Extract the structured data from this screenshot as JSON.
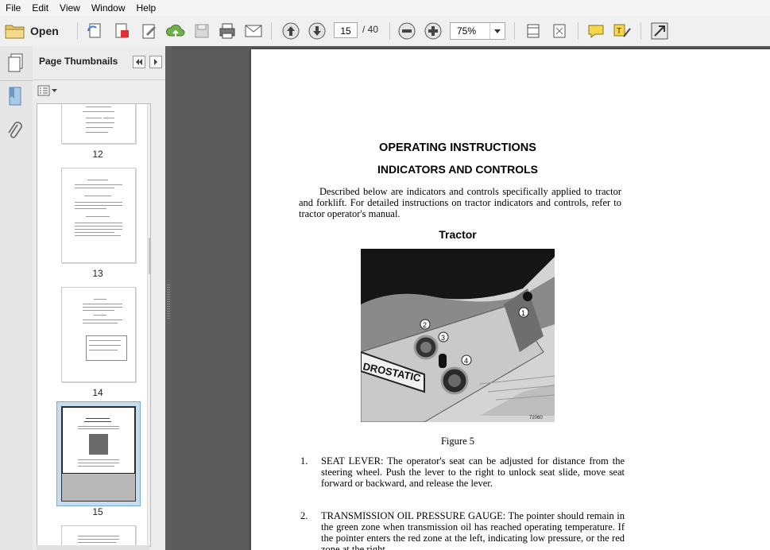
{
  "menu": [
    "File",
    "Edit",
    "View",
    "Window",
    "Help"
  ],
  "toolbar": {
    "open_label": "Open",
    "current_page": "15",
    "page_total": "/ 40",
    "zoom": "75%"
  },
  "nav_panel": {
    "title": "Page Thumbnails",
    "thumbnails": [
      {
        "label": "12"
      },
      {
        "label": "13"
      },
      {
        "label": "14"
      },
      {
        "label": "15",
        "selected": true
      }
    ]
  },
  "document": {
    "heading1": "OPERATING INSTRUCTIONS",
    "heading2": "INDICATORS AND CONTROLS",
    "intro": "Described below are indicators and controls specifically applied to tractor and forklift. For detailed instructions on tractor indicators and controls, refer to tractor operator's manual.",
    "section_title": "Tractor",
    "figure_caption": "Figure 5",
    "figure_code": "72060",
    "figure_decal": "DROSTATIC",
    "callouts": [
      "1",
      "2",
      "3",
      "4"
    ],
    "items": [
      {
        "num": "1.",
        "text": "SEAT LEVER: The operator's seat can be adjusted for distance from the steering wheel. Push the lever to the right to unlock seat slide, move seat forward or backward, and release the lever."
      },
      {
        "num": "2.",
        "text": "TRANSMISSION OIL PRESSURE GAUGE: The pointer should remain in the green zone when transmission oil has reached operating temperature. If the pointer enters the red zone at the left, indicating low pressure, or the red zone at the right,"
      }
    ]
  },
  "colors": {
    "doc_background": "#5a5a5a",
    "selected_thumb": "#c5dcef",
    "toolbar_blue": "#3b7dd8"
  }
}
